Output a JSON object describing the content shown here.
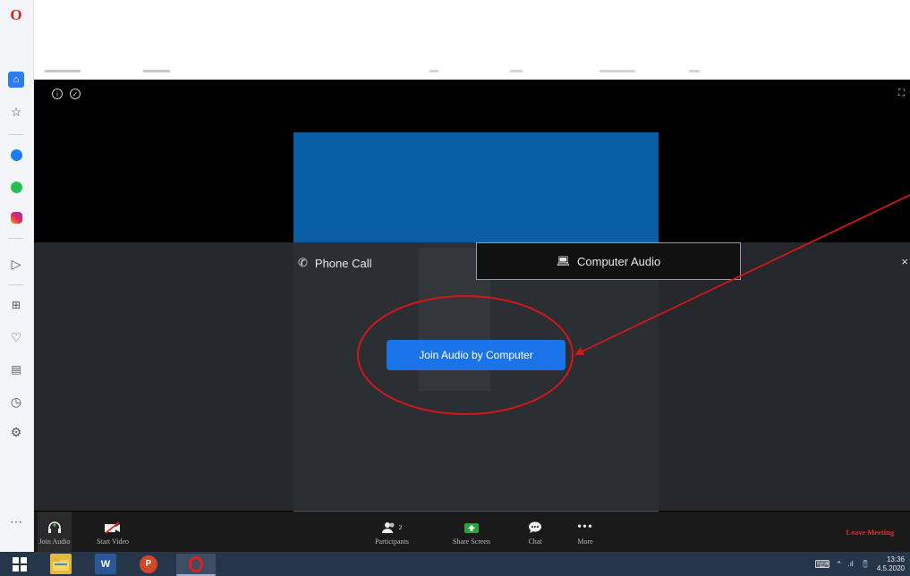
{
  "sidebar": {
    "logo": "opera-logo",
    "items": [
      {
        "name": "home-icon"
      },
      {
        "name": "star-icon"
      },
      {
        "name": "messenger-icon"
      },
      {
        "name": "whatsapp-icon"
      },
      {
        "name": "instagram-icon"
      },
      {
        "name": "send-icon"
      },
      {
        "name": "speed-dial-icon"
      },
      {
        "name": "heart-icon"
      },
      {
        "name": "news-icon"
      },
      {
        "name": "history-icon"
      },
      {
        "name": "settings-icon"
      },
      {
        "name": "more-icon"
      }
    ]
  },
  "zoom": {
    "audio_dialog": {
      "tab_phone": "Phone Call",
      "tab_computer": "Computer Audio",
      "join_button": "Join Audio by Computer"
    },
    "toolbar": {
      "join_audio": "Join Audio",
      "start_video": "Start Video",
      "participants": "Participants",
      "participants_count": "2",
      "share_screen": "Share Screen",
      "chat": "Chat",
      "more": "More",
      "leave": "Leave Meeting"
    }
  },
  "taskbar": {
    "time": "13:36",
    "date": "4.5.2020"
  },
  "colors": {
    "zoom_blue": "#1a73e8",
    "video_blue": "#0a5ea6",
    "share_green": "#26a536",
    "leave_red": "#e02a2a",
    "annotation_red": "#d01818"
  }
}
